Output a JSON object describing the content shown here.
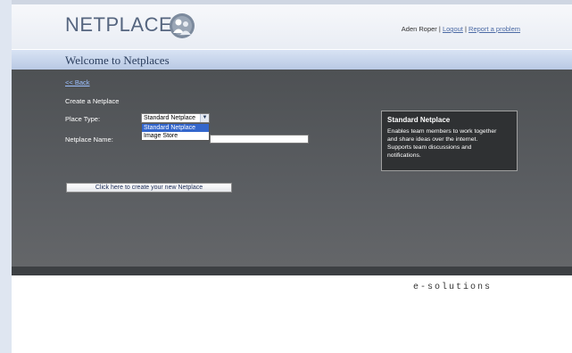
{
  "header": {
    "logo_text": "NETPLACES",
    "user_name": "Aden Roper",
    "logout_label": "Logout",
    "report_label": "Report a problem",
    "separator": "|"
  },
  "welcome": {
    "title": "Welcome to Netplaces"
  },
  "form": {
    "back_label": "<< Back",
    "section_title": "Create a Netplace",
    "place_type_label": "Place Type:",
    "place_type_selected": "Standard Netplace",
    "place_type_options": [
      "Standard Netplace",
      "Image Store"
    ],
    "netplace_name_label": "Netplace Name:",
    "netplace_name_value": "",
    "create_button_label": "Click here to create your new Netplace"
  },
  "info_box": {
    "title": "Standard Netplace",
    "lines": [
      "Enables team members to work together",
      "and share ideas over the internet.",
      "Supports team discussions and",
      "notifications."
    ]
  },
  "footer": {
    "brand": "e-solutions"
  },
  "colors": {
    "header_bg": "#eef1f6",
    "welcome_bar": "#c8d6ee",
    "panel_bg": "#55585c",
    "link": "#4b6aa5",
    "dropdown_highlight": "#3366cc"
  },
  "icons": {
    "logo": "people-globe-icon",
    "select_arrow": "chevron-down-icon"
  }
}
